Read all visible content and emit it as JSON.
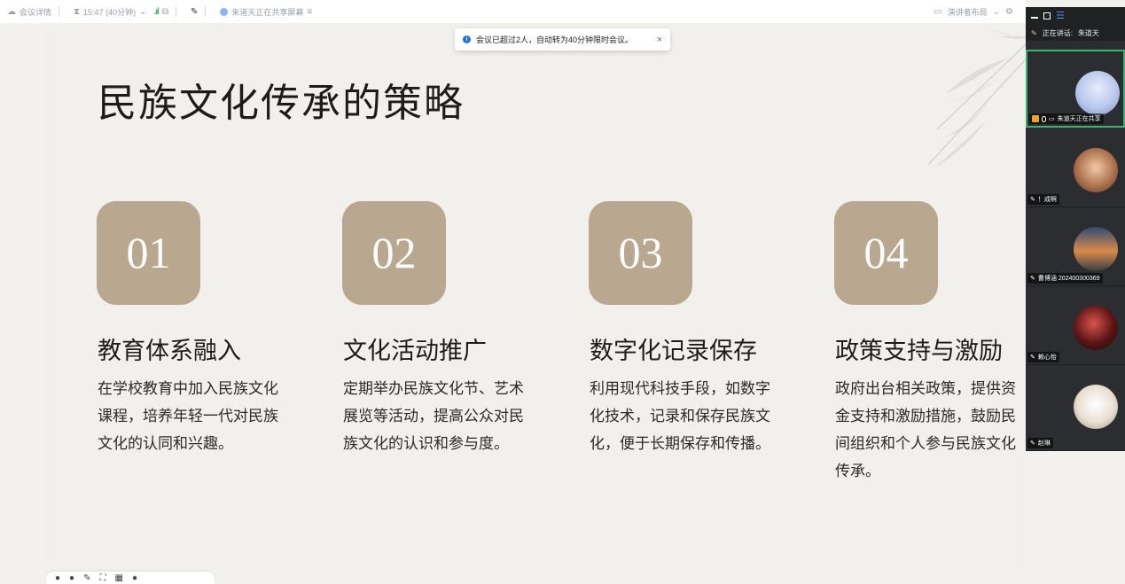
{
  "topbar": {
    "meeting_info": "会议详情",
    "timer": "15:47 (40分钟)",
    "sharing_status": "朱道天正在共享屏幕",
    "layout_button": "演讲者布局"
  },
  "toast": {
    "message": "会议已超过2人，自动转为40分钟限时会议。",
    "close": "×"
  },
  "slide": {
    "title": "民族文化传承的策略",
    "cards": [
      {
        "num": "01",
        "title": "教育体系融入",
        "desc": "在学校教育中加入民族文化课程，培养年轻一代对民族文化的认同和兴趣。"
      },
      {
        "num": "02",
        "title": "文化活动推广",
        "desc": "定期举办民族文化节、艺术展览等活动，提高公众对民族文化的认识和参与度。"
      },
      {
        "num": "03",
        "title": "数字化记录保存",
        "desc": "利用现代科技手段，如数字化技术，记录和保存民族文化，便于长期保存和传播。"
      },
      {
        "num": "04",
        "title": "政策支持与激励",
        "desc": "政府出台相关政策，提供资金支持和激励措施，鼓励民间组织和个人参与民族文化传承。"
      }
    ],
    "accent_color": "#b9a88f"
  },
  "panel": {
    "speaking_label": "正在讲话:",
    "speaking_name": "朱道天",
    "participants": [
      {
        "name": "朱道天正在共享",
        "active": true
      },
      {
        "name": "！成啊"
      },
      {
        "name": "曹博涵 202400300369"
      },
      {
        "name": "赖心怡"
      },
      {
        "name": "赵琳"
      }
    ]
  }
}
